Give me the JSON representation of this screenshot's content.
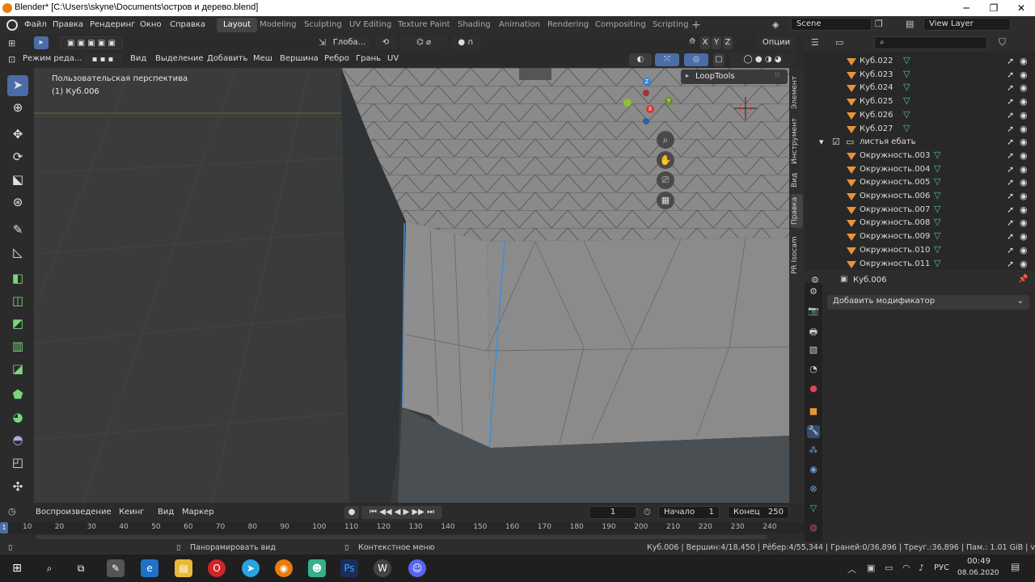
{
  "window": {
    "title": "Blender* [C:\\Users\\skyne\\Documents\\остров и дерево.blend]",
    "minimize": "─",
    "maximize": "❐",
    "close": "✕"
  },
  "menu": {
    "file": "Файл",
    "edit": "Правка",
    "render": "Рендеринг",
    "window": "Окно",
    "help": "Справка"
  },
  "workspaces": [
    "Layout",
    "Modeling",
    "Sculpting",
    "UV Editing",
    "Texture Paint",
    "Shading",
    "Animation",
    "Rendering",
    "Compositing",
    "Scripting"
  ],
  "scene": {
    "name": "Scene",
    "view_layer": "View Layer"
  },
  "header1": {
    "orientation": "Глоба...",
    "options": "Опции",
    "axis_x": "X",
    "axis_y": "Y",
    "axis_z": "Z"
  },
  "header2": {
    "mode": "Режим реда...",
    "menus": [
      "Вид",
      "Выделение",
      "Добавить",
      "Меш",
      "Вершина",
      "Ребро",
      "Грань",
      "UV"
    ]
  },
  "viewport": {
    "perspective": "Пользовательская перспектива",
    "object": "(1) Куб.006",
    "loop_tools": "LoopTools",
    "gizmo": {
      "x": "X",
      "y": "Y",
      "z": "Z"
    }
  },
  "sidebar_tabs": [
    "Элемент",
    "Инструмент",
    "Вид",
    "Правка",
    "PR Isocam"
  ],
  "outliner": {
    "cubes": [
      "Куб.022",
      "Куб.023",
      "Куб.024",
      "Куб.025",
      "Куб.026",
      "Куб.027"
    ],
    "collection": "листья ебать",
    "circles": [
      "Окружность.003",
      "Окружность.004",
      "Окружность.005",
      "Окружность.006",
      "Окружность.007",
      "Окружность.008",
      "Окружность.009",
      "Окружность.010",
      "Окружность.011"
    ]
  },
  "properties": {
    "object": "Куб.006",
    "add_modifier": "Добавить модификатор"
  },
  "timeline": {
    "playback": "Воспроизведение",
    "keying": "Кеинг",
    "view": "Вид",
    "marker": "Маркер",
    "current_frame": "1",
    "start_label": "Начало",
    "start": "1",
    "end_label": "Конец",
    "end": "250",
    "ruler": [
      "10",
      "20",
      "30",
      "40",
      "50",
      "60",
      "70",
      "80",
      "90",
      "100",
      "110",
      "120",
      "130",
      "140",
      "150",
      "160",
      "170",
      "180",
      "190",
      "200",
      "210",
      "220",
      "230",
      "240"
    ],
    "cursor": "1"
  },
  "status": {
    "pan": "Панорамировать вид",
    "context": "Контекстное меню",
    "stats": "Куб.006 | Вершин:4/18,450 | Рёбер:4/55,344 | Граней:0/36,896 | Треуг.:36,896 | Пам.: 1.01 GiB | v2.82.7"
  },
  "taskbar": {
    "lang": "РУС",
    "time": "00:49",
    "date": "08.06.2020"
  },
  "colors": {
    "accent": "#4a6da8",
    "select_edge": "#3d8fd9",
    "object_orange": "#e8933a",
    "mesh_green": "#4fc6a0"
  }
}
